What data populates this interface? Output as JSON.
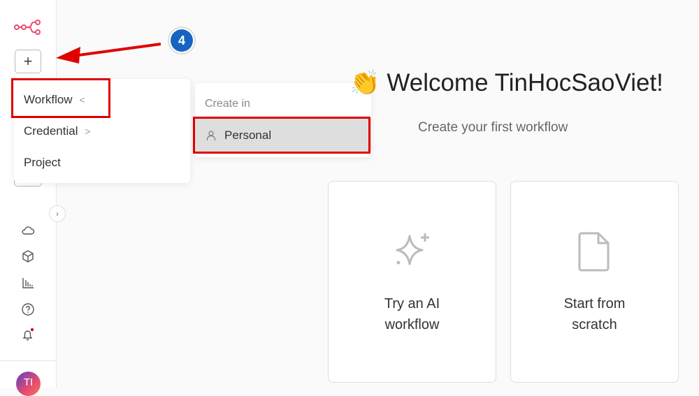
{
  "sidebar": {
    "avatar_initials": "TI",
    "icons": [
      "n8n-logo-icon",
      "cloud-icon",
      "package-icon",
      "bar-chart-icon",
      "help-icon",
      "bell-icon"
    ]
  },
  "menu": {
    "items": [
      {
        "label": "Workflow"
      },
      {
        "label": "Credential"
      },
      {
        "label": "Project"
      }
    ]
  },
  "submenu": {
    "header": "Create in",
    "items": [
      {
        "label": "Personal"
      }
    ]
  },
  "main": {
    "title": "Welcome TinHocSaoViet!",
    "subtitle": "Create your first workflow",
    "cards": [
      {
        "line1": "Try an AI",
        "line2": "workflow"
      },
      {
        "line1": "Start from",
        "line2": "scratch"
      }
    ]
  },
  "annotation": {
    "step": "4",
    "color": "#e00000"
  },
  "colors": {
    "brand": "#ea4b71",
    "badge": "#1565c0",
    "highlight": "#e00000"
  }
}
